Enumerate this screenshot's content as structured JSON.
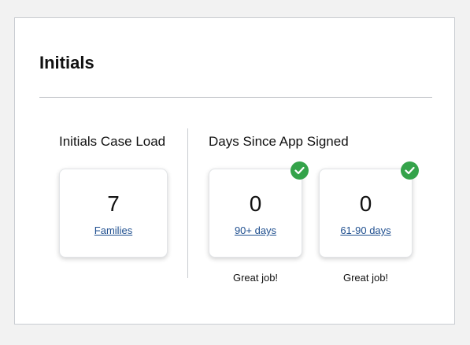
{
  "panel": {
    "title": "Initials"
  },
  "case_load": {
    "heading": "Initials Case Load",
    "card": {
      "value": "7",
      "link_label": "Families"
    }
  },
  "days_since": {
    "heading": "Days Since App Signed",
    "cards": [
      {
        "value": "0",
        "link_label": "90+ days",
        "status": "Great job!",
        "badge_icon": "checkmark-icon"
      },
      {
        "value": "0",
        "link_label": "61-90 days",
        "status": "Great job!",
        "badge_icon": "checkmark-icon"
      }
    ]
  },
  "colors": {
    "success_badge": "#34a34a",
    "link": "#1f4f8f",
    "border": "#c9ccd1"
  }
}
